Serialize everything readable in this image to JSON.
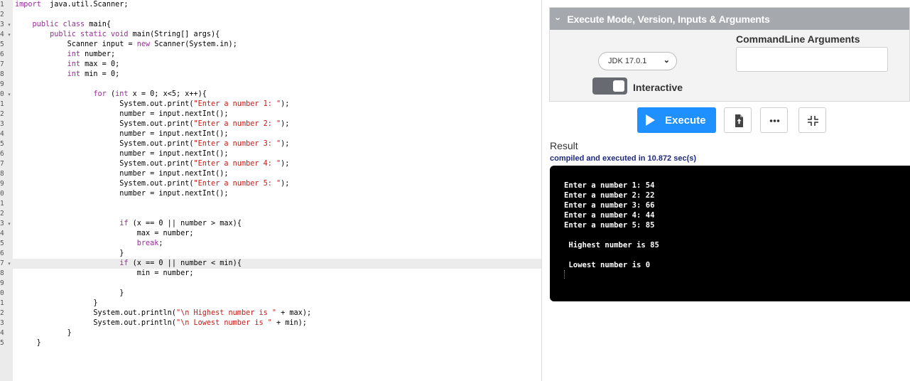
{
  "editor": {
    "line_numbers": [
      "1",
      "2",
      "3",
      "4",
      "5",
      "6",
      "7",
      "8",
      "9",
      "0",
      "1",
      "2",
      "3",
      "4",
      "5",
      "6",
      "7",
      "8",
      "9",
      "0",
      "1",
      "2",
      "3",
      "4",
      "5",
      "6",
      "7",
      "8",
      "9",
      "0",
      "1",
      "2",
      "3",
      "4",
      "5"
    ],
    "fold_markers": [
      "",
      "",
      "▾",
      "▾",
      "",
      "",
      "",
      "",
      "",
      "▾",
      "",
      "",
      "",
      "",
      "",
      "",
      "",
      "",
      "",
      "",
      "",
      "",
      "▾",
      "",
      "",
      "",
      "▾",
      "",
      "",
      "",
      "",
      "",
      "",
      "",
      ""
    ],
    "active_line": 26,
    "lines": [
      [
        [
          "kw",
          "import"
        ],
        [
          "",
          "  java.util.Scanner;"
        ]
      ],
      [],
      [
        [
          "",
          "    "
        ],
        [
          "kw",
          "public class"
        ],
        [
          "",
          " main{"
        ]
      ],
      [
        [
          "",
          "        "
        ],
        [
          "kw",
          "public static void"
        ],
        [
          "",
          " main(String[] args){"
        ]
      ],
      [
        [
          "",
          "            Scanner input = "
        ],
        [
          "kw",
          "new"
        ],
        [
          "",
          " Scanner(System.in);"
        ]
      ],
      [
        [
          "",
          "            "
        ],
        [
          "kw",
          "int"
        ],
        [
          "",
          " number;"
        ]
      ],
      [
        [
          "",
          "            "
        ],
        [
          "kw",
          "int"
        ],
        [
          "",
          " max = 0;"
        ]
      ],
      [
        [
          "",
          "            "
        ],
        [
          "kw",
          "int"
        ],
        [
          "",
          " min = 0;"
        ]
      ],
      [],
      [
        [
          "",
          "                  "
        ],
        [
          "kw",
          "for"
        ],
        [
          "",
          " ("
        ],
        [
          "kw",
          "int"
        ],
        [
          "",
          " x = 0; x<5; x++){"
        ]
      ],
      [
        [
          "",
          "                        System.out.print("
        ],
        [
          "str",
          "\"Enter a number 1: \""
        ],
        [
          "",
          ");"
        ]
      ],
      [
        [
          "",
          "                        number = input.nextInt();"
        ]
      ],
      [
        [
          "",
          "                        System.out.print("
        ],
        [
          "str",
          "\"Enter a number 2: \""
        ],
        [
          "",
          ");"
        ]
      ],
      [
        [
          "",
          "                        number = input.nextInt();"
        ]
      ],
      [
        [
          "",
          "                        System.out.print("
        ],
        [
          "str",
          "\"Enter a number 3: \""
        ],
        [
          "",
          ");"
        ]
      ],
      [
        [
          "",
          "                        number = input.nextInt();"
        ]
      ],
      [
        [
          "",
          "                        System.out.print("
        ],
        [
          "str",
          "\"Enter a number 4: \""
        ],
        [
          "",
          ");"
        ]
      ],
      [
        [
          "",
          "                        number = input.nextInt();"
        ]
      ],
      [
        [
          "",
          "                        System.out.print("
        ],
        [
          "str",
          "\"Enter a number 5: \""
        ],
        [
          "",
          ");"
        ]
      ],
      [
        [
          "",
          "                        number = input.nextInt();"
        ]
      ],
      [],
      [],
      [
        [
          "",
          "                        "
        ],
        [
          "kw",
          "if"
        ],
        [
          "",
          " (x == 0 || number > max){"
        ]
      ],
      [
        [
          "",
          "                            max = number;"
        ]
      ],
      [
        [
          "",
          "                            "
        ],
        [
          "kw",
          "break"
        ],
        [
          "",
          ";"
        ]
      ],
      [
        [
          "",
          "                        }"
        ]
      ],
      [
        [
          "",
          "                        "
        ],
        [
          "kw",
          "if"
        ],
        [
          "",
          " (x == 0 || number < min){"
        ]
      ],
      [
        [
          "",
          "                            min = number;"
        ]
      ],
      [],
      [
        [
          "",
          "                        }"
        ]
      ],
      [
        [
          "",
          "                  }"
        ]
      ],
      [
        [
          "",
          "                  System.out.println("
        ],
        [
          "str",
          "\"\\n Highest number is \""
        ],
        [
          "",
          " + max);"
        ]
      ],
      [
        [
          "",
          "                  System.out.println("
        ],
        [
          "str",
          "\"\\n Lowest number is \""
        ],
        [
          "",
          " + min);"
        ]
      ],
      [
        [
          "",
          "            }"
        ]
      ],
      [
        [
          "",
          "     }"
        ]
      ]
    ]
  },
  "panel": {
    "header_title": "Execute Mode, Version, Inputs & Arguments",
    "jdk_version": "JDK 17.0.1",
    "interactive_label": "Interactive",
    "args_label": "CommandLine Arguments",
    "args_value": ""
  },
  "toolbar": {
    "execute_label": "Execute",
    "accent_color": "#1e90ff"
  },
  "result": {
    "label": "Result",
    "status": "compiled and executed in 10.872 sec(s)",
    "output_lines": [
      "Enter a number 1: 54",
      "Enter a number 2: 22",
      "Enter a number 3: 66",
      "Enter a number 4: 44",
      "Enter a number 5: 85",
      "",
      " Highest number is 85",
      "",
      " Lowest number is 0"
    ]
  }
}
